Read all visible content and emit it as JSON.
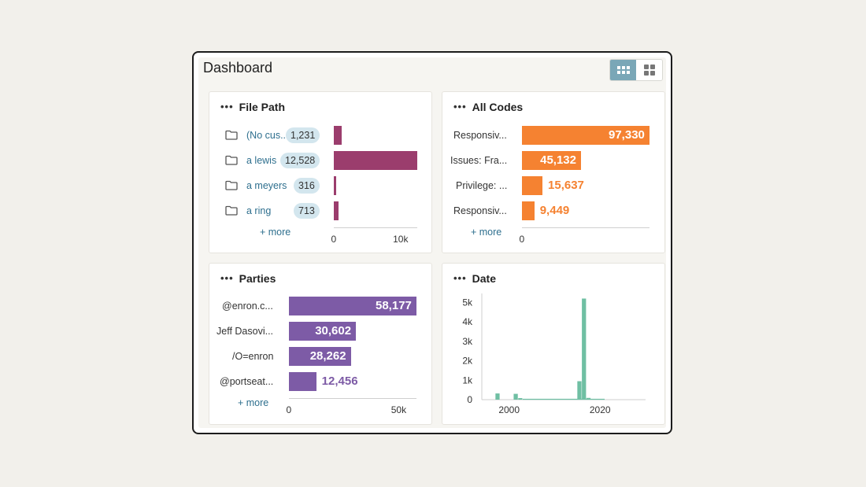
{
  "dashboard": {
    "title": "Dashboard",
    "toggle_icons": [
      "grid-3x3-icon",
      "grid-2x2-icon"
    ]
  },
  "colors": {
    "file_path_bar": "#9b3d6d",
    "all_codes_bar": "#f58231",
    "parties_bar": "#7d5ba6",
    "date_bar": "#6fbfa3",
    "link": "#2e6f8e"
  },
  "file_path": {
    "title": "File Path",
    "more": "+ more",
    "chart_data": {
      "type": "bar",
      "orientation": "horizontal",
      "categories": [
        "(No cus...",
        "a lewis",
        "a meyers",
        "a ring"
      ],
      "values": [
        1231,
        12528,
        316,
        713
      ],
      "value_labels": [
        "1,231",
        "12,528",
        "316",
        "713"
      ],
      "xlim": [
        0,
        12528
      ],
      "ticks": [
        {
          "v": 0,
          "label": "0"
        },
        {
          "v": 10000,
          "label": "10k"
        }
      ]
    }
  },
  "all_codes": {
    "title": "All Codes",
    "more": "+ more",
    "chart_data": {
      "type": "bar",
      "orientation": "horizontal",
      "categories": [
        "Responsiv...",
        "Issues: Fra...",
        "Privilege: ...",
        "Responsiv..."
      ],
      "values": [
        97330,
        45132,
        15637,
        9449
      ],
      "value_labels": [
        "97,330",
        "45,132",
        "15,637",
        "9,449"
      ],
      "xlim": [
        0,
        97330
      ],
      "ticks": [
        {
          "v": 0,
          "label": "0"
        }
      ]
    }
  },
  "parties": {
    "title": "Parties",
    "more": "+ more",
    "chart_data": {
      "type": "bar",
      "orientation": "horizontal",
      "categories": [
        "@enron.c...",
        "Jeff Dasovi...",
        "/O=enron",
        "@portseat..."
      ],
      "values": [
        58177,
        30602,
        28262,
        12456
      ],
      "value_labels": [
        "58,177",
        "30,602",
        "28,262",
        "12,456"
      ],
      "xlim": [
        0,
        58177
      ],
      "ticks": [
        {
          "v": 0,
          "label": "0"
        },
        {
          "v": 50000,
          "label": "50k"
        }
      ]
    }
  },
  "date": {
    "title": "Date",
    "chart_data": {
      "type": "bar",
      "x": [
        1997,
        2001,
        2002,
        2015,
        2016,
        2017
      ],
      "values": [
        320,
        300,
        80,
        950,
        5200,
        90
      ],
      "xlim": [
        1994,
        2030
      ],
      "ylim": [
        0,
        5300
      ],
      "yticks": [
        {
          "v": 0,
          "label": "0"
        },
        {
          "v": 1000,
          "label": "1k"
        },
        {
          "v": 2000,
          "label": "2k"
        },
        {
          "v": 3000,
          "label": "3k"
        },
        {
          "v": 4000,
          "label": "4k"
        },
        {
          "v": 5000,
          "label": "5k"
        }
      ],
      "xticks": [
        {
          "v": 2000,
          "label": "2000"
        },
        {
          "v": 2020,
          "label": "2020"
        }
      ]
    }
  }
}
